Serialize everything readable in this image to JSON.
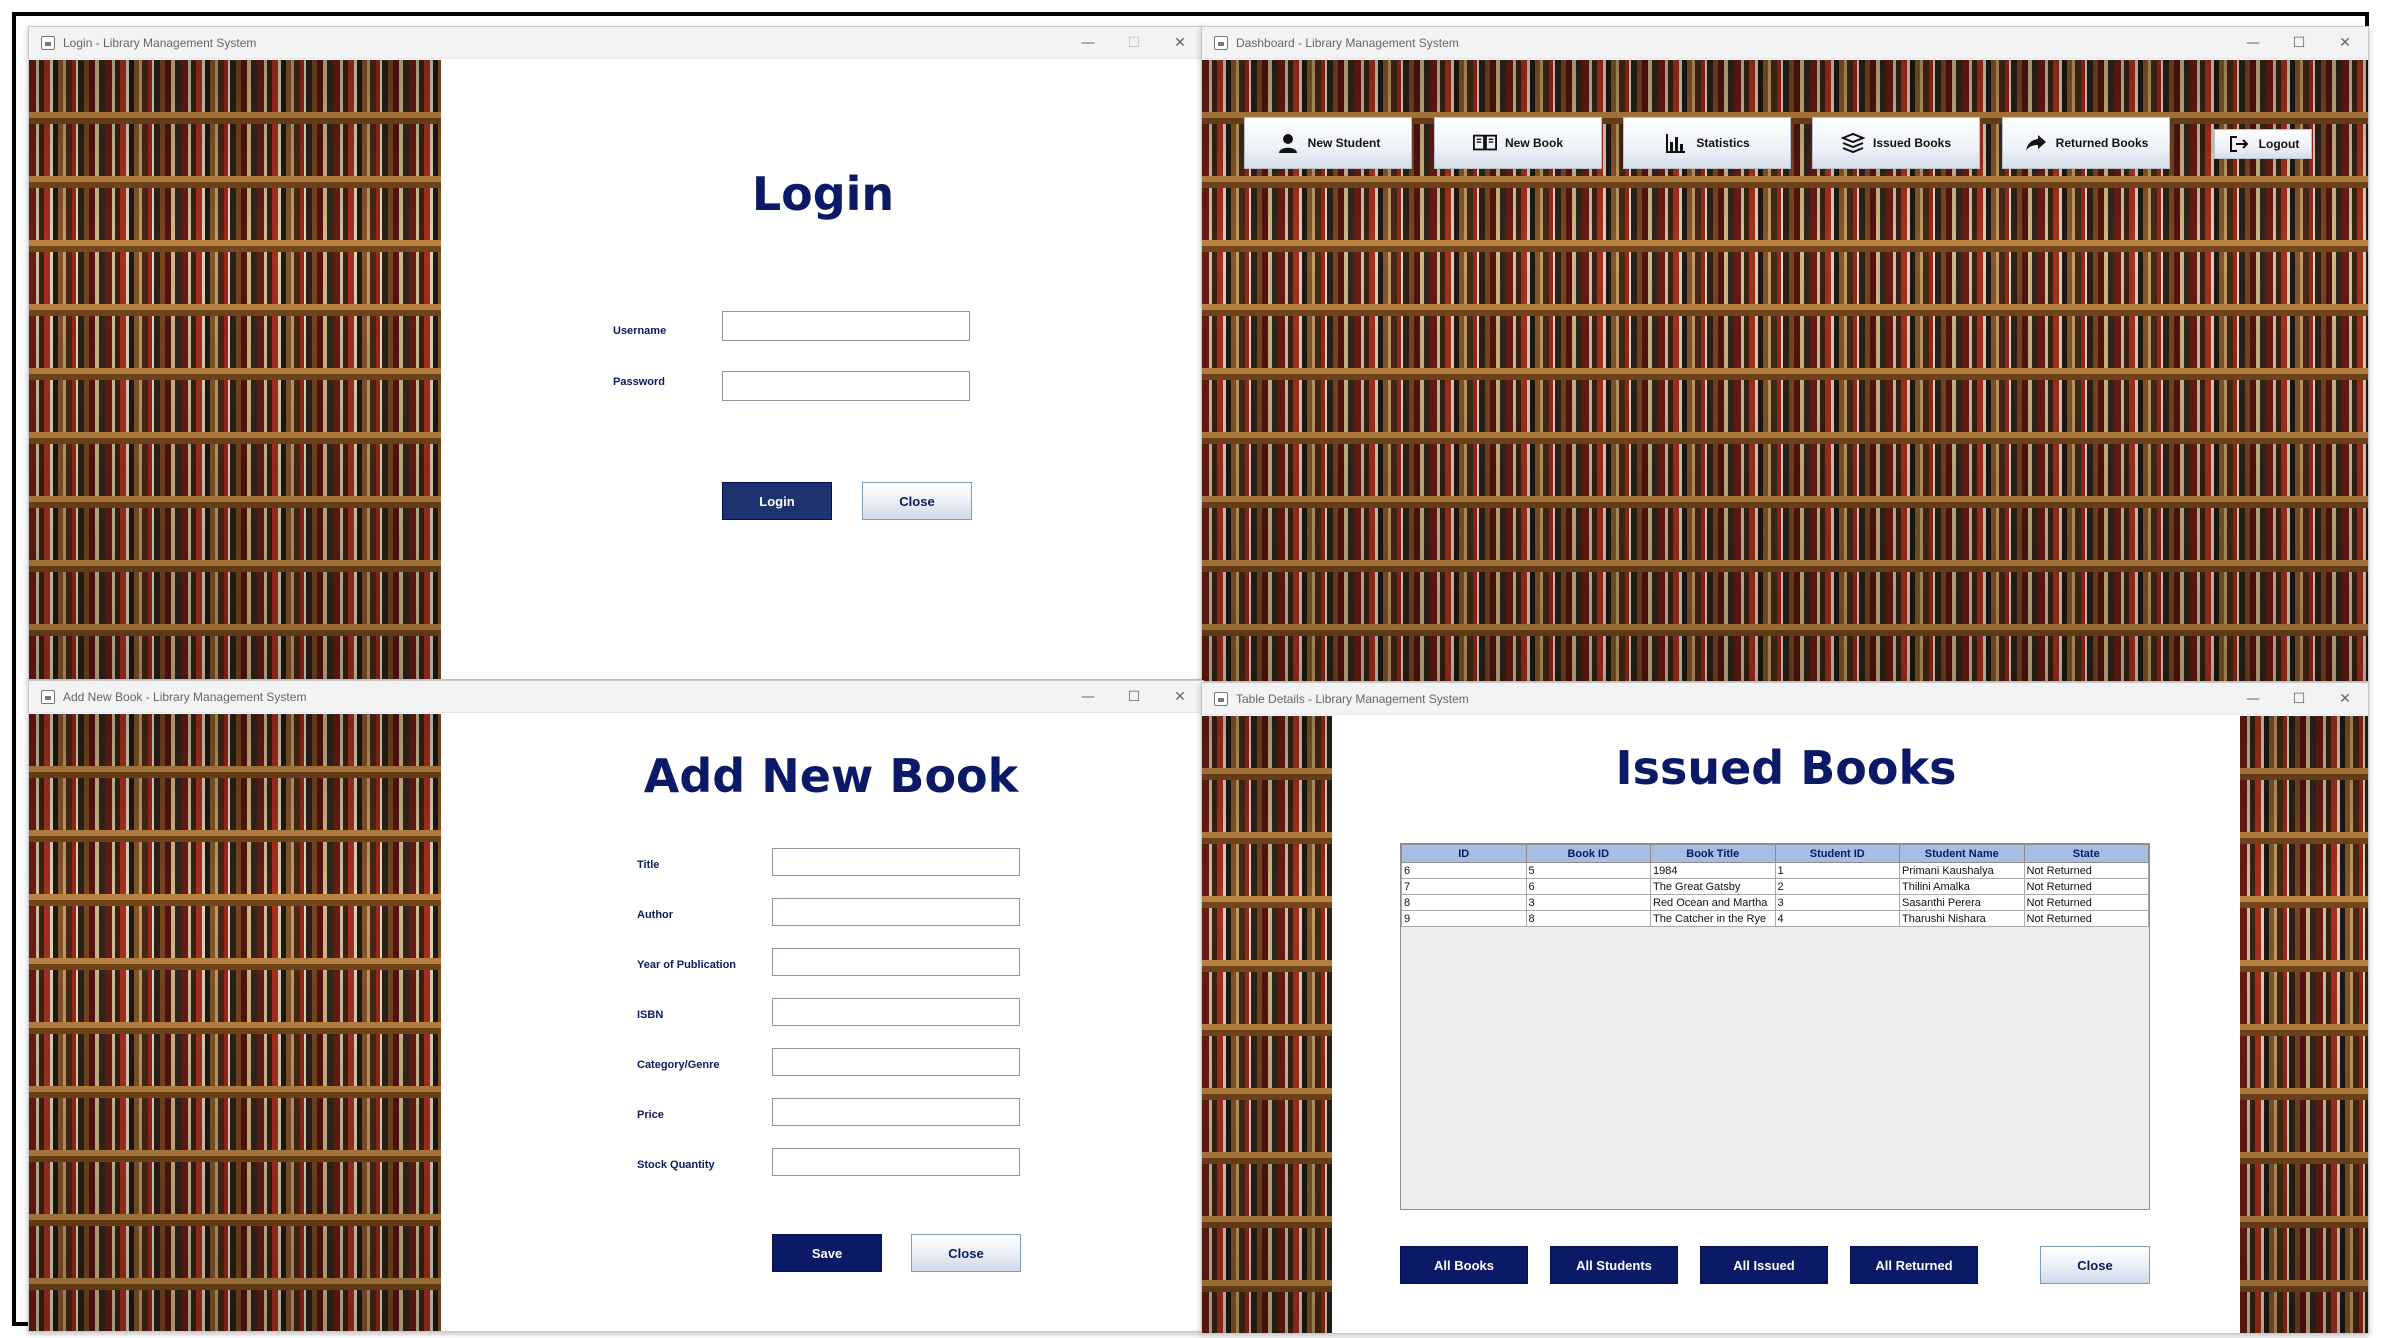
{
  "login": {
    "window_title": "Login - Library Management System",
    "heading": "Login",
    "username_label": "Username",
    "username_value": "",
    "password_label": "Password",
    "password_value": "",
    "login_button": "Login",
    "close_button": "Close"
  },
  "dashboard": {
    "window_title": "Dashboard - Library Management System",
    "buttons": [
      {
        "label": "New Student",
        "icon": "user-icon"
      },
      {
        "label": "New Book",
        "icon": "book-open-icon"
      },
      {
        "label": "Statistics",
        "icon": "bar-chart-icon"
      },
      {
        "label": "Issued Books",
        "icon": "book-stack-icon"
      },
      {
        "label": "Returned Books",
        "icon": "share-arrow-icon"
      }
    ],
    "logout_label": "Logout",
    "logout_icon": "logout-icon"
  },
  "add_book": {
    "window_title": "Add New Book - Library Management System",
    "heading": "Add New Book",
    "fields": [
      {
        "label": "Title",
        "value": ""
      },
      {
        "label": "Author",
        "value": ""
      },
      {
        "label": "Year of Publication",
        "value": ""
      },
      {
        "label": "ISBN",
        "value": ""
      },
      {
        "label": "Category/Genre",
        "value": ""
      },
      {
        "label": "Price",
        "value": ""
      },
      {
        "label": "Stock Quantity",
        "value": ""
      }
    ],
    "save_button": "Save",
    "close_button": "Close"
  },
  "table_details": {
    "window_title": "Table Details - Library Management System",
    "heading": "Issued Books",
    "columns": [
      "ID",
      "Book ID",
      "Book Title",
      "Student ID",
      "Student Name",
      "State"
    ],
    "rows": [
      [
        "6",
        "5",
        "1984",
        "1",
        "Primani Kaushalya",
        "Not Returned"
      ],
      [
        "7",
        "6",
        "The Great Gatsby",
        "2",
        "Thilini Amalka",
        "Not Returned"
      ],
      [
        "8",
        "3",
        "Red Ocean and Martha",
        "3",
        "Sasanthi Perera",
        "Not Returned"
      ],
      [
        "9",
        "8",
        "The Catcher in the Rye",
        "4",
        "Tharushi Nishara",
        "Not Returned"
      ]
    ],
    "buttons": {
      "all_books": "All Books",
      "all_students": "All Students",
      "all_issued": "All Issued",
      "all_returned": "All Returned",
      "close": "Close"
    }
  },
  "window_controls": {
    "minimize": "—",
    "maximize": "☐",
    "close": "✕"
  },
  "colors": {
    "navy": "#0b1a66",
    "header_blue": "#a7bde3",
    "login_button": "#1f3270"
  }
}
